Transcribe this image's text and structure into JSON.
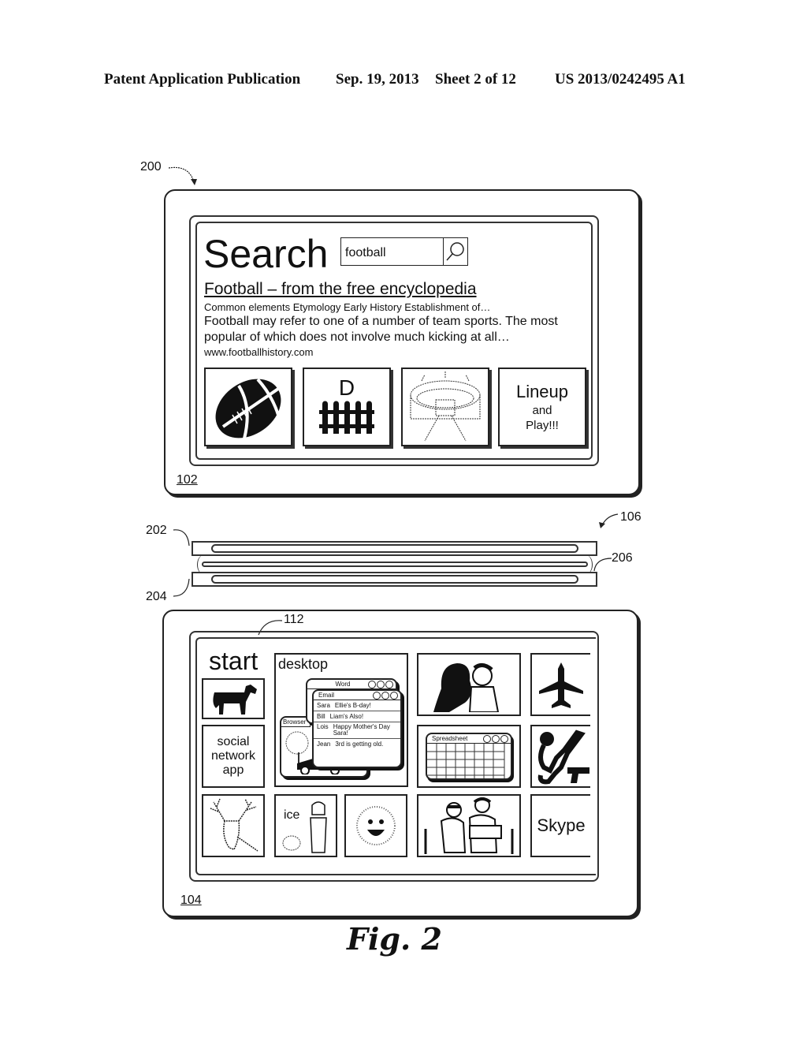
{
  "header": {
    "left": "Patent Application Publication",
    "date": "Sep. 19, 2013",
    "sheet": "Sheet 2 of 12",
    "number": "US 2013/0242495 A1"
  },
  "refs": {
    "r200": "200",
    "r102": "102",
    "r106": "106",
    "r202": "202",
    "r204": "204",
    "r206": "206",
    "r112": "112",
    "r104": "104"
  },
  "top_screen": {
    "title": "Search",
    "search_value": "football",
    "search_icon": "magnifier-icon",
    "result_title": "Football – from the free encyclopedia",
    "result_sublinks": "Common elements  Etymology Early History Establishment of…",
    "result_snippet_1": "Football may refer to one of a number of team sports.  The most",
    "result_snippet_2": "popular of which does not involve much kicking at all…",
    "result_url": "www.footballhistory.com",
    "tiles": [
      {
        "icon": "football-icon"
      },
      {
        "label": "D",
        "icon": "fence-icon"
      },
      {
        "icon": "stadium-icon"
      },
      {
        "line1": "Lineup",
        "line2": "and",
        "line3": "Play!!!"
      }
    ]
  },
  "bottom_screen": {
    "start_label": "start",
    "desktop_label": "desktop",
    "windows": {
      "word": "Word",
      "email": "Email",
      "browser": "Browser",
      "spreadsheet": "Spreadsheet"
    },
    "emails": [
      {
        "from": "Sara",
        "subject": "Ellie's B-day!"
      },
      {
        "from": "Bill",
        "subject": "Liam's Also!"
      },
      {
        "from": "Lois",
        "subject": "Happy Mother's Day Sara!"
      },
      {
        "from": "Jean",
        "subject": "3rd is getting old."
      }
    ],
    "social_tile": [
      "social",
      "network",
      "app"
    ],
    "ice_label": "ice",
    "skype_label": "Skype"
  },
  "figure_caption": "Fig. 2"
}
